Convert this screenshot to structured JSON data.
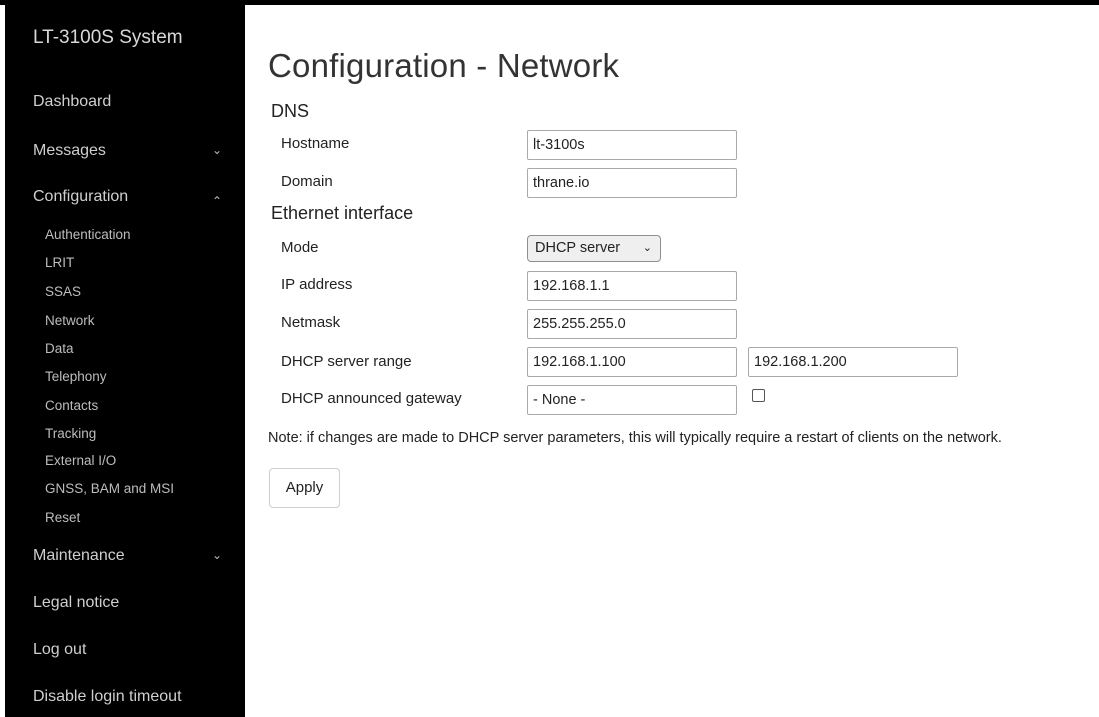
{
  "sidebar": {
    "brand": "LT-3100S System",
    "items": {
      "dashboard": "Dashboard",
      "messages": "Messages",
      "configuration": "Configuration",
      "maintenance": "Maintenance",
      "legal": "Legal notice",
      "logout": "Log out",
      "disable_timeout": "Disable login timeout"
    },
    "chevrons": {
      "down": "⌄",
      "up": "⌃"
    },
    "config_sub": [
      "Authentication",
      "LRIT",
      "SSAS",
      "Network",
      "Data",
      "Telephony",
      "Contacts",
      "Tracking",
      "External I/O",
      "GNSS, BAM and MSI",
      "Reset"
    ]
  },
  "main": {
    "title": "Configuration - Network",
    "dns": {
      "heading": "DNS",
      "hostname_label": "Hostname",
      "hostname_value": "lt-3100s",
      "domain_label": "Domain",
      "domain_value": "thrane.io"
    },
    "ethernet": {
      "heading": "Ethernet interface",
      "mode_label": "Mode",
      "mode_value": "DHCP server",
      "ip_label": "IP address",
      "ip_value": "192.168.1.1",
      "netmask_label": "Netmask",
      "netmask_value": "255.255.255.0",
      "range_label": "DHCP server range",
      "range_start": "192.168.1.100",
      "range_end": "192.168.1.200",
      "gateway_label": "DHCP announced gateway",
      "gateway_value": "- None -"
    },
    "note": "Note: if changes are made to DHCP server parameters, this will typically require a restart of clients on the network.",
    "apply_label": "Apply"
  }
}
